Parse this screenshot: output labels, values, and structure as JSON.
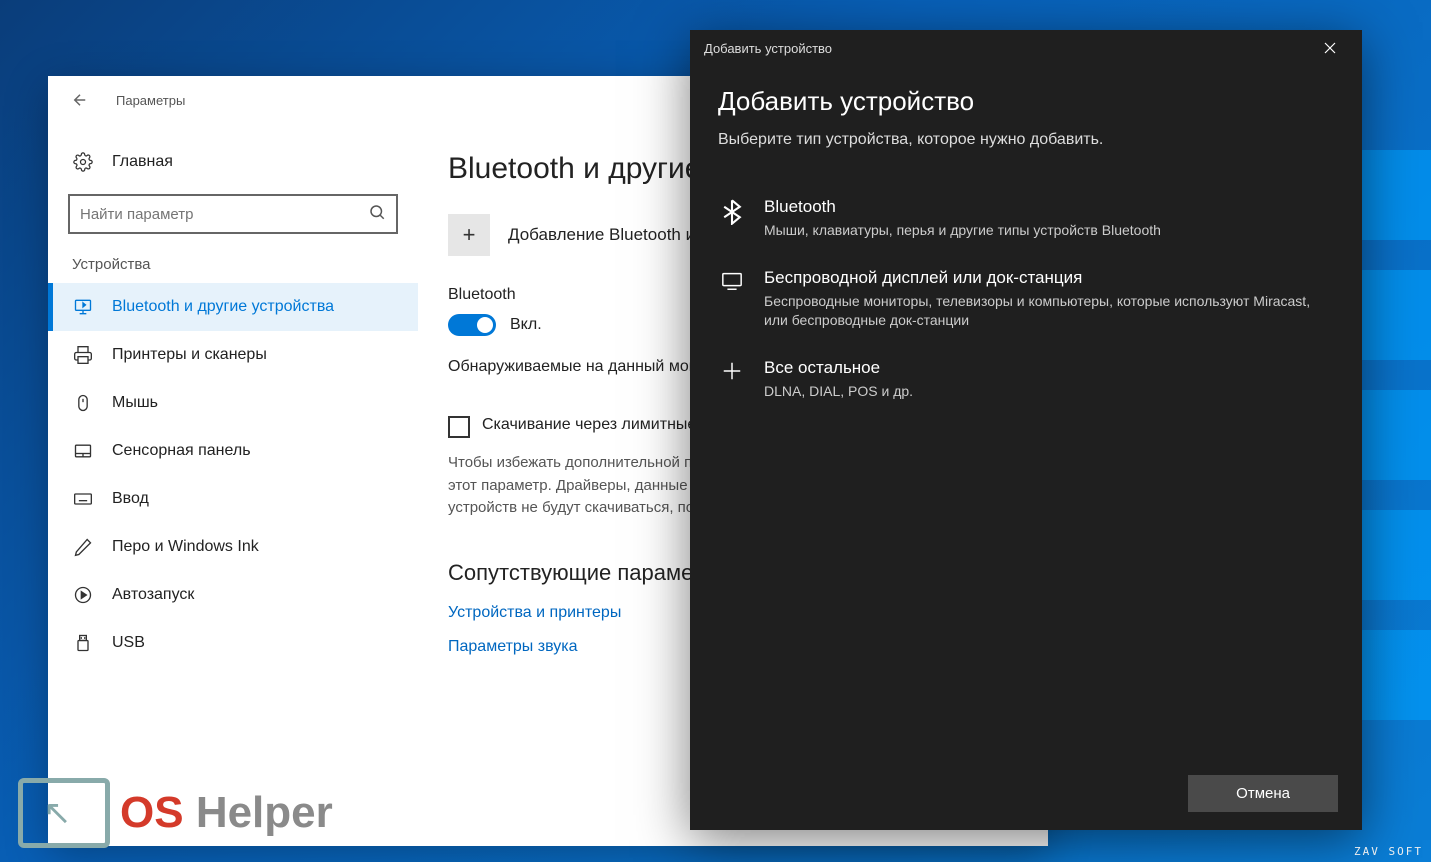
{
  "settings": {
    "header_title": "Параметры",
    "home_label": "Главная",
    "search_placeholder": "Найти параметр",
    "section_label": "Устройства",
    "nav": [
      {
        "label": "Bluetooth и другие устройства",
        "icon": "bluetooth"
      },
      {
        "label": "Принтеры и сканеры",
        "icon": "printer"
      },
      {
        "label": "Мышь",
        "icon": "mouse"
      },
      {
        "label": "Сенсорная панель",
        "icon": "touchpad"
      },
      {
        "label": "Ввод",
        "icon": "keyboard"
      },
      {
        "label": "Перо и Windows Ink",
        "icon": "pen"
      },
      {
        "label": "Автозапуск",
        "icon": "autoplay"
      },
      {
        "label": "USB",
        "icon": "usb"
      }
    ]
  },
  "main": {
    "title": "Bluetooth и другие устройства",
    "add_label": "Добавление Bluetooth или другого устройства",
    "bt_label": "Bluetooth",
    "bt_state": "Вкл.",
    "discoverable": "Обнаруживаемые на данный момент как",
    "checkbox_label": "Скачивание через лимитные подключения",
    "desc": "Чтобы избежать дополнительной платы, оставьте выключенным этот параметр. Драйверы, данные и приложения для новых устройств не будут скачиваться, пока вы подключены к Интернету.",
    "related_heading": "Сопутствующие параметры",
    "link1": "Устройства и принтеры",
    "link2": "Параметры звука"
  },
  "dialog": {
    "titlebar": "Добавить устройство",
    "heading": "Добавить устройство",
    "sub": "Выберите тип устройства, которое нужно добавить.",
    "types": [
      {
        "title": "Bluetooth",
        "desc": "Мыши, клавиатуры, перья и другие типы устройств Bluetooth"
      },
      {
        "title": "Беспроводной дисплей или док-станция",
        "desc": "Беспроводные мониторы, телевизоры и компьютеры, которые используют Miracast, или беспроводные док-станции"
      },
      {
        "title": "Все остальное",
        "desc": "DLNA, DIAL, POS и др."
      }
    ],
    "cancel": "Отмена"
  },
  "watermark": {
    "os": "OS",
    "helper": "Helper",
    "zav": "ZAV SOFT"
  }
}
